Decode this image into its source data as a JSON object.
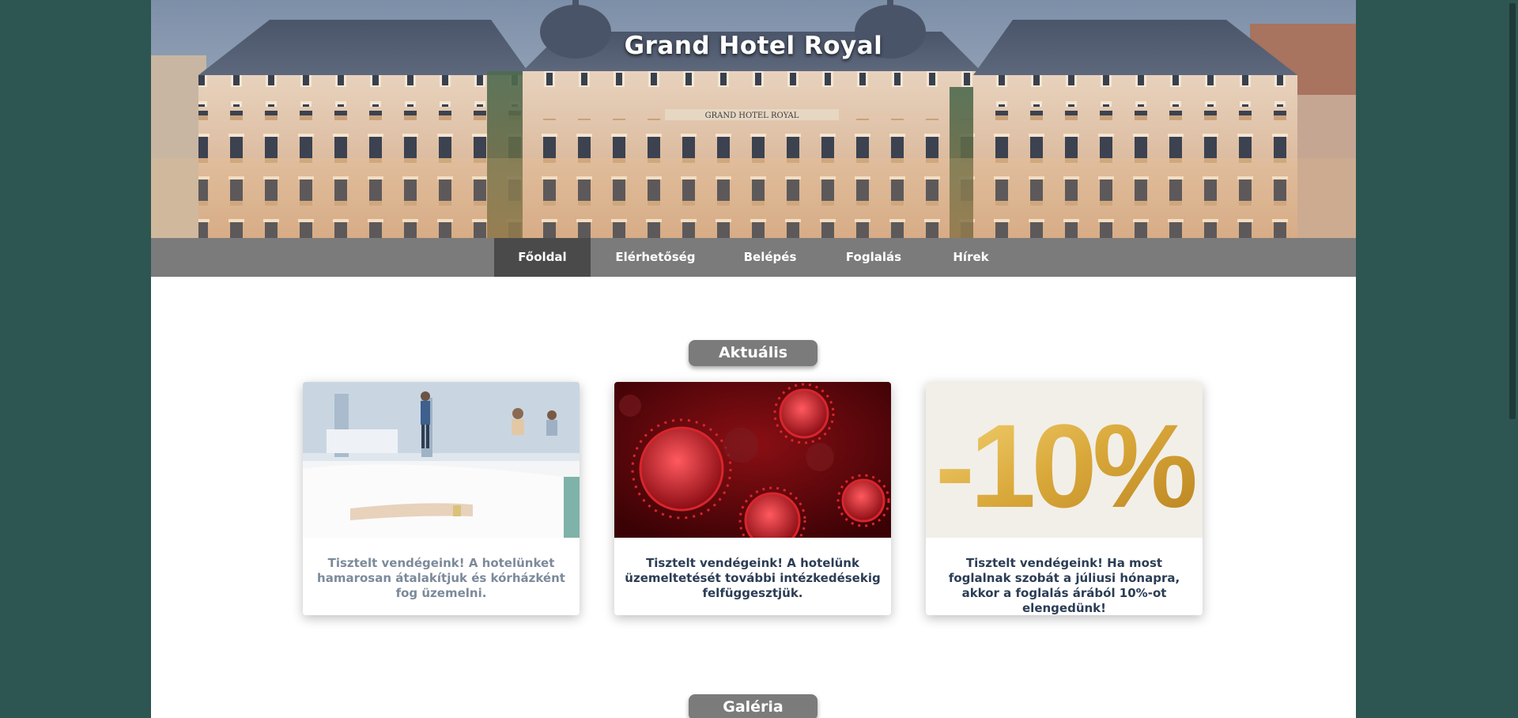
{
  "site": {
    "title": "Grand Hotel Royal"
  },
  "nav": {
    "items": [
      {
        "label": "Főoldal",
        "active": true
      },
      {
        "label": "Elérhetőség",
        "active": false
      },
      {
        "label": "Belépés",
        "active": false
      },
      {
        "label": "Foglalás",
        "active": false
      },
      {
        "label": "Hírek",
        "active": false
      }
    ]
  },
  "sections": {
    "current": {
      "title": "Aktuális"
    },
    "gallery": {
      "title": "Galéria"
    }
  },
  "hero": {
    "sign_text": "GRAND HOTEL ROYAL"
  },
  "cards": [
    {
      "image_icon": "hospital-ward-image",
      "text": "Tisztelt vendégeink! A hotelünket hamarosan átalakítjuk és kórházként fog üzemelni."
    },
    {
      "image_icon": "coronavirus-image",
      "text": "Tisztelt vendégeink! A hotelünk üzemeltetését további intézkedésekig felfüggesztjük."
    },
    {
      "image_icon": "discount-image",
      "image_text": "-10%",
      "text": "Tisztelt vendégeink! Ha most foglalnak szobát a júliusi hónapra, akkor a foglalás árából 10%-ot elengedünk!"
    }
  ],
  "colors": {
    "background": "#2d5551",
    "nav": "#7b7b7b",
    "nav_active": "#4a4a4a",
    "card_text": "#2b3d55",
    "discount_gold": "#d9a83a"
  }
}
